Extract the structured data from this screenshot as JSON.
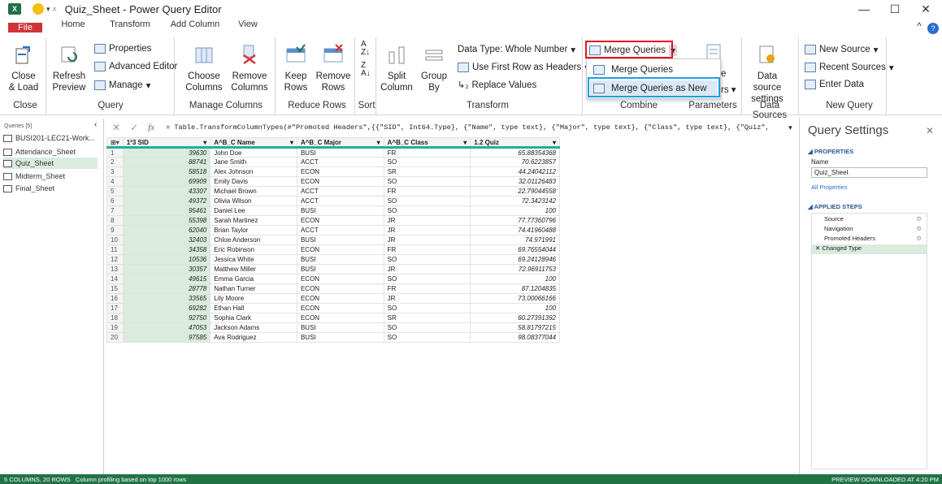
{
  "window": {
    "title": "Quiz_Sheet - Power Query Editor",
    "app_icon": "excel-icon",
    "minimize": "—",
    "maximize": "☐",
    "close": "✕"
  },
  "tabs": [
    "File",
    "Home",
    "Transform",
    "Add Column",
    "View"
  ],
  "ribbon": {
    "close_load": "Close & Load",
    "refresh": "Refresh Preview",
    "properties": "Properties",
    "advanced_editor": "Advanced Editor",
    "manage": "Manage",
    "choose_columns": "Choose Columns",
    "remove_columns": "Remove Columns",
    "keep_rows": "Keep Rows",
    "remove_rows": "Remove Rows",
    "split_column": "Split Column",
    "group_by": "Group By",
    "data_type": "Data Type: Whole Number",
    "first_row_headers": "Use First Row as Headers",
    "replace_values": "Replace Values",
    "merge_queries": "Merge Queries",
    "data_source_settings": "Data source settings",
    "new_source": "New Source",
    "recent_sources": "Recent Sources",
    "enter_data": "Enter Data",
    "groups": [
      "Close",
      "Query",
      "Manage Columns",
      "Reduce Rows",
      "Sort",
      "Transform",
      "Combine",
      "Parameters",
      "Data Sources",
      "New Query"
    ]
  },
  "merge_menu": [
    "Merge Queries",
    "Merge Queries as New"
  ],
  "formula": "= Table.TransformColumnTypes(#\"Promoted Headers\",{{\"SID\", Int64.Type}, {\"Name\", type text}, {\"Major\", type text}, {\"Class\", type text}, {\"Quiz\", type number}})",
  "queries": {
    "header": "Queries [5]",
    "items": [
      "BUSI201-LEC21-Work...",
      "Attendance_Sheet",
      "Quiz_Sheet",
      "Midterm_Sheet",
      "Final_Sheet"
    ],
    "selected": "Quiz_Sheet"
  },
  "columns": [
    "SID",
    "Name",
    "Major",
    "Class",
    "Quiz"
  ],
  "column_types": [
    "1²3",
    "A^B_C",
    "A^B_C",
    "A^B_C",
    "1.2"
  ],
  "rows": [
    [
      "39630",
      "John Doe",
      "BUSI",
      "FR",
      "65.88354368"
    ],
    [
      "88741",
      "Jane Smith",
      "ACCT",
      "SO",
      "70.6223857"
    ],
    [
      "58518",
      "Alex Johnson",
      "ECON",
      "SR",
      "44.24042112"
    ],
    [
      "69909",
      "Emily Davis",
      "ECON",
      "SO",
      "32.01126483"
    ],
    [
      "43307",
      "Michael Brown",
      "ACCT",
      "FR",
      "22.79044558"
    ],
    [
      "49372",
      "Olivia Wilson",
      "ACCT",
      "SO",
      "72.3423142"
    ],
    [
      "95461",
      "Daniel Lee",
      "BUSI",
      "SO",
      "100"
    ],
    [
      "55398",
      "Sarah Martinez",
      "ECON",
      "JR",
      "77.77360796"
    ],
    [
      "62040",
      "Brian Taylor",
      "ACCT",
      "JR",
      "74.41960488"
    ],
    [
      "32403",
      "Chloe Anderson",
      "BUSI",
      "JR",
      "74.971991"
    ],
    [
      "34358",
      "Eric Robinson",
      "ECON",
      "FR",
      "69.76554044"
    ],
    [
      "10536",
      "Jessica White",
      "BUSI",
      "SO",
      "69.24128946"
    ],
    [
      "30357",
      "Matthew Miller",
      "BUSI",
      "JR",
      "72.96911753"
    ],
    [
      "49615",
      "Emma Garcia",
      "ECON",
      "SO",
      "100"
    ],
    [
      "28778",
      "Nathan Turner",
      "ECON",
      "FR",
      "87.1204835"
    ],
    [
      "33565",
      "Lily Moore",
      "ECON",
      "JR",
      "73.00066166"
    ],
    [
      "69282",
      "Ethan Hall",
      "ECON",
      "SO",
      "100"
    ],
    [
      "92750",
      "Sophia Clark",
      "ECON",
      "SR",
      "60.27391392"
    ],
    [
      "47053",
      "Jackson Adams",
      "BUSI",
      "SO",
      "58.81797215"
    ],
    [
      "97585",
      "Ava Rodriguez",
      "BUSI",
      "SO",
      "98.08377044"
    ]
  ],
  "query_settings": {
    "title": "Query Settings",
    "properties_header": "PROPERTIES",
    "name_label": "Name",
    "name_value": "Quiz_Sheet",
    "all_properties": "All Properties",
    "steps_header": "APPLIED STEPS",
    "steps": [
      "Source",
      "Navigation",
      "Promoted Headers",
      "Changed Type"
    ]
  },
  "status": {
    "left": "5 COLUMNS, 20 ROWS   Column profiling based on top 1000 rows",
    "right": "PREVIEW DOWNLOADED AT 4:20 PM"
  },
  "colors": {
    "status_green": "#217346",
    "file_red": "#d13438",
    "highlight_red": "#e81123",
    "highlight_blue": "#1a9fe0",
    "accent_teal": "#17b3a0"
  }
}
